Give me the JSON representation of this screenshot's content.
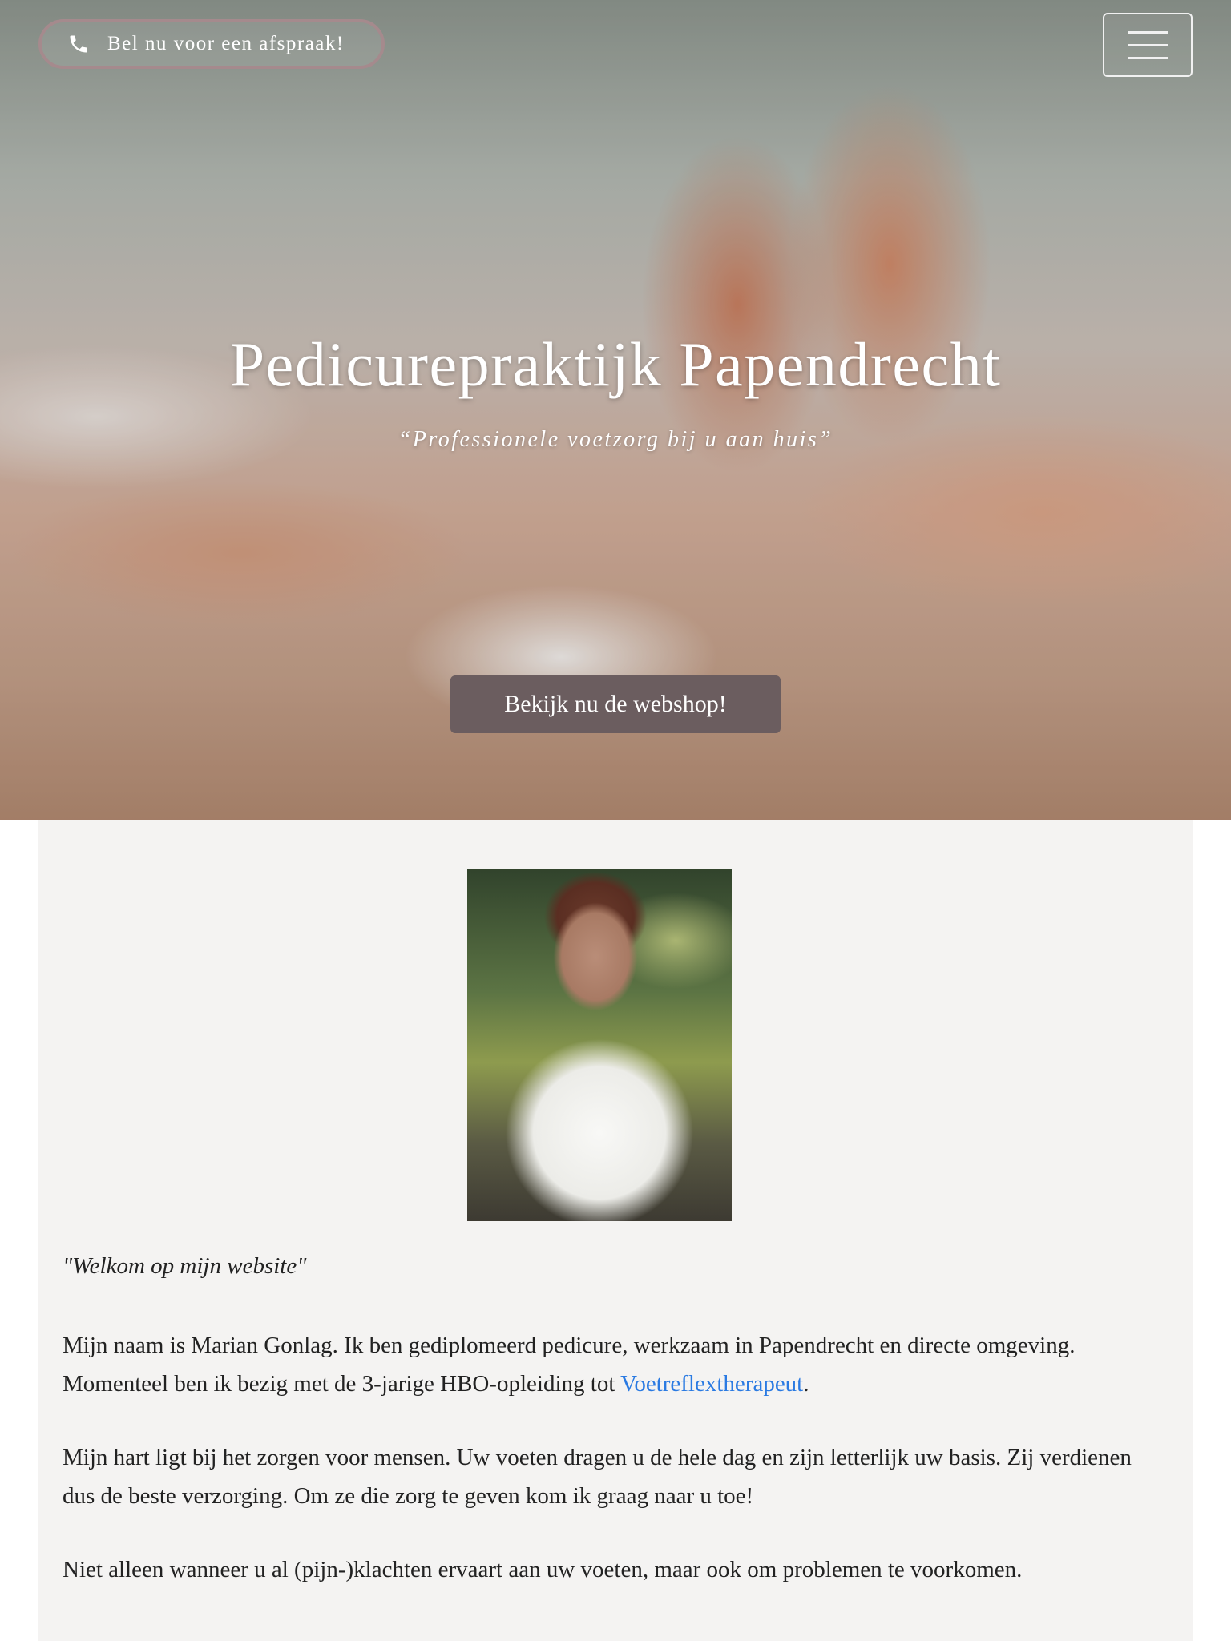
{
  "header": {
    "call_button_label": "Bel nu voor een afspraak!",
    "call_icon": "phone-icon",
    "menu_icon": "hamburger-menu-icon"
  },
  "hero": {
    "title": "Pedicurepraktijk Papendrecht",
    "subtitle": "“Professionele voetzorg bij u aan huis”",
    "cta_label": "Bekijk nu de webshop!"
  },
  "content": {
    "welcome": "\"Welkom op mijn website\"",
    "p1_text": "Mijn naam is Marian Gonlag. Ik ben gediplomeerd pedicure, werkzaam in Papendrecht en directe omgeving. Momenteel ben ik bezig met de 3-jarige HBO-opleiding tot ",
    "p1_link": "Voetreflextherapeut",
    "p1_end": ".",
    "p2": "Mijn hart ligt bij het zorgen voor mensen. Uw voeten dragen u de hele dag en zijn letterlijk uw basis. Zij verdienen dus de beste verzorging. Om ze die zorg te geven kom ik graag naar u toe!",
    "p3": "Niet alleen wanneer u al (pijn-)klachten ervaart aan uw voeten, maar ook om problemen te voorkomen."
  },
  "colors": {
    "call_border": "#a58a8d",
    "cta_background": "#6b5d5f",
    "content_background": "#f4f3f2",
    "link": "#2a7ae2"
  }
}
